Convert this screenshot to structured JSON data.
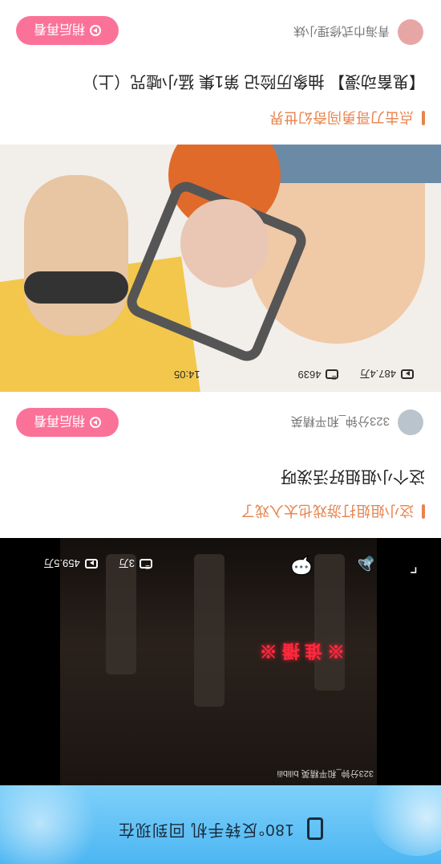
{
  "banner": {
    "text": "180°反转手机 回到现在"
  },
  "player": {
    "watermark": "323分钟_和平精英 bilibili",
    "effect_text": "※ 谁 播 ※",
    "plays": "459.5万",
    "danmaku": "3万"
  },
  "cards": [
    {
      "tagline": "这小姐姐打游戏也太入戏了",
      "title": "这个小姐姐好活泼呀",
      "author": "323分钟_和平精英",
      "replay_label": "稍后再看"
    },
    {
      "tagline": "点击刀哥勇闯奇幻世界",
      "title": "【鬼畜动漫】 抽象历险记 第1集 猛小嘘咒（上）",
      "author": "青海巾式修理小妹",
      "replay_label": "稍后再看",
      "plays": "487.4万",
      "danmaku": "4639",
      "duration": "14:05"
    }
  ]
}
